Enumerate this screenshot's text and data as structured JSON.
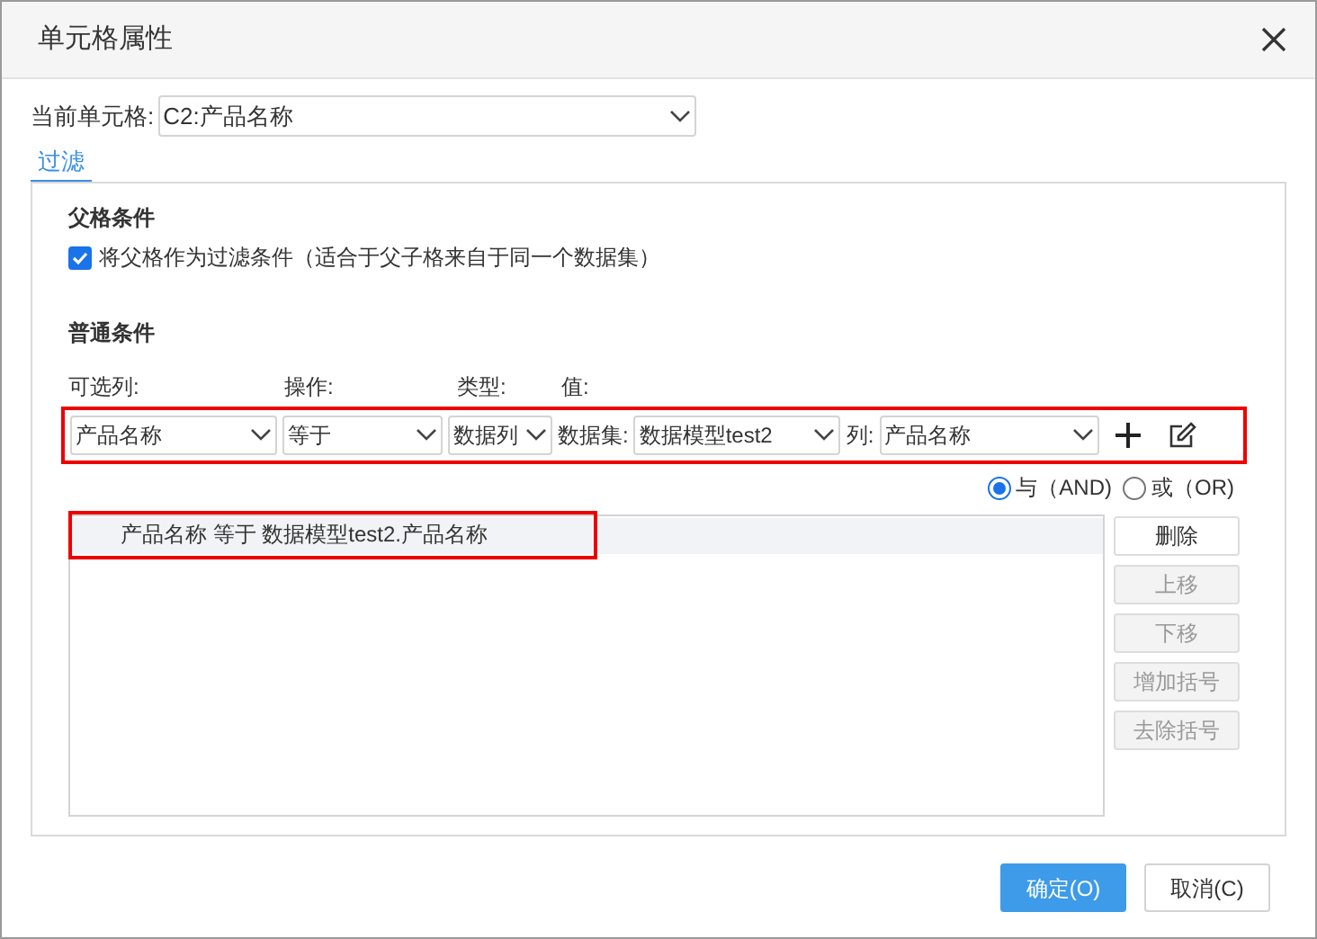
{
  "window": {
    "title": "单元格属性"
  },
  "current_cell": {
    "label": "当前单元格:",
    "value": "C2:产品名称"
  },
  "tabs": [
    {
      "label": "过滤",
      "selected": true
    }
  ],
  "parent_condition": {
    "heading": "父格条件",
    "checkbox": {
      "label": "将父格作为过滤条件（适合于父子格来自于同一个数据集）",
      "checked": true
    }
  },
  "normal_condition": {
    "heading": "普通条件",
    "column_headers": [
      "可选列:",
      "操作:",
      "类型:",
      "值:"
    ],
    "row": {
      "highlighted": true,
      "column": "产品名称",
      "operator": "等于",
      "type": "数据列",
      "dataset_label": "数据集:",
      "dataset": "数据模型test2",
      "col_label": "列:",
      "col_value": "产品名称"
    },
    "logic": [
      {
        "label": "与（AND)",
        "selected": true
      },
      {
        "label": "或（OR)",
        "selected": false
      }
    ],
    "conditions": [
      {
        "text": "产品名称 等于 数据模型test2.产品名称",
        "selected": true,
        "highlighted": true
      }
    ],
    "side_buttons": [
      {
        "label": "删除",
        "disabled": false
      },
      {
        "label": "上移",
        "disabled": true
      },
      {
        "label": "下移",
        "disabled": true
      },
      {
        "label": "增加括号",
        "disabled": true
      },
      {
        "label": "去除括号",
        "disabled": true
      }
    ]
  },
  "buttons": [
    {
      "label": "确定(O)",
      "kind": "primary"
    },
    {
      "label": "取消(C)",
      "kind": "secondary"
    }
  ]
}
